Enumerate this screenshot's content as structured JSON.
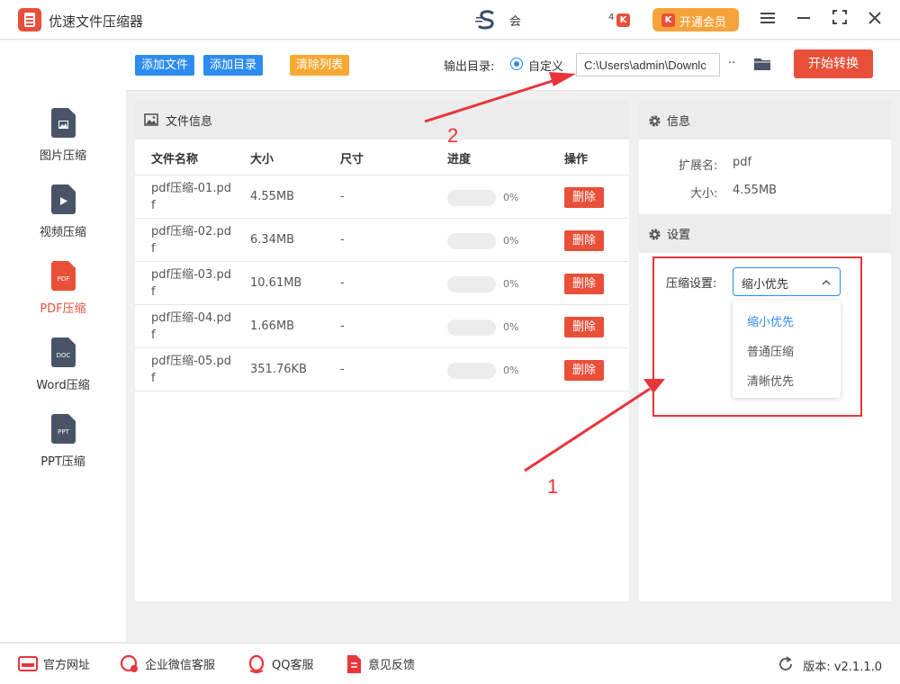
{
  "app": {
    "title": "优速文件压缩器",
    "member_short": "会",
    "vip_num": "4",
    "vip_label": "开通会员"
  },
  "sidebar": {
    "items": [
      {
        "label": "图片压缩",
        "tag": ""
      },
      {
        "label": "视频压缩",
        "tag": ""
      },
      {
        "label": "PDF压缩",
        "tag": "PDF"
      },
      {
        "label": "Word压缩",
        "tag": "DOC"
      },
      {
        "label": "PPT压缩",
        "tag": "PPT"
      }
    ]
  },
  "toolbar": {
    "add_file": "添加文件",
    "add_dir": "添加目录",
    "clear_list": "清除列表",
    "output_label": "输出目录:",
    "custom_label": "自定义",
    "output_path": "C:\\Users\\admin\\Downlc",
    "dots": "··",
    "start": "开始转换"
  },
  "file_panel": {
    "title": "文件信息",
    "headers": {
      "name": "文件名称",
      "size": "大小",
      "dim": "尺寸",
      "progress": "进度",
      "action": "操作"
    },
    "rows": [
      {
        "name": "pdf压缩-01.pdf",
        "size": "4.55MB",
        "dim": "-",
        "progress": 0,
        "pct": "0%",
        "action": "删除"
      },
      {
        "name": "pdf压缩-02.pdf",
        "size": "6.34MB",
        "dim": "-",
        "progress": 0,
        "pct": "0%",
        "action": "删除"
      },
      {
        "name": "pdf压缩-03.pdf",
        "size": "10.61MB",
        "dim": "-",
        "progress": 0,
        "pct": "0%",
        "action": "删除"
      },
      {
        "name": "pdf压缩-04.pdf",
        "size": "1.66MB",
        "dim": "-",
        "progress": 0,
        "pct": "0%",
        "action": "删除"
      },
      {
        "name": "pdf压缩-05.pdf",
        "size": "351.76KB",
        "dim": "-",
        "progress": 0,
        "pct": "0%",
        "action": "删除"
      }
    ]
  },
  "info": {
    "title": "信息",
    "ext_label": "扩展名:",
    "ext_value": "pdf",
    "size_label": "大小:",
    "size_value": "4.55MB"
  },
  "settings": {
    "title": "设置",
    "compress_label": "压缩设置:",
    "selected": "缩小优先",
    "options": [
      "缩小优先",
      "普通压缩",
      "清晰优先"
    ]
  },
  "annotations": {
    "label_1": "1",
    "label_2": "2"
  },
  "footer": {
    "site": "官方网址",
    "wechat": "企业微信客服",
    "qq": "QQ客服",
    "feedback": "意见反馈",
    "version_label": "版本:",
    "version": "v2.1.1.0"
  },
  "colors": {
    "accent": "#e8503a",
    "blue": "#2d8cf0",
    "orange": "#f7a833",
    "annotation": "#e8343a"
  }
}
